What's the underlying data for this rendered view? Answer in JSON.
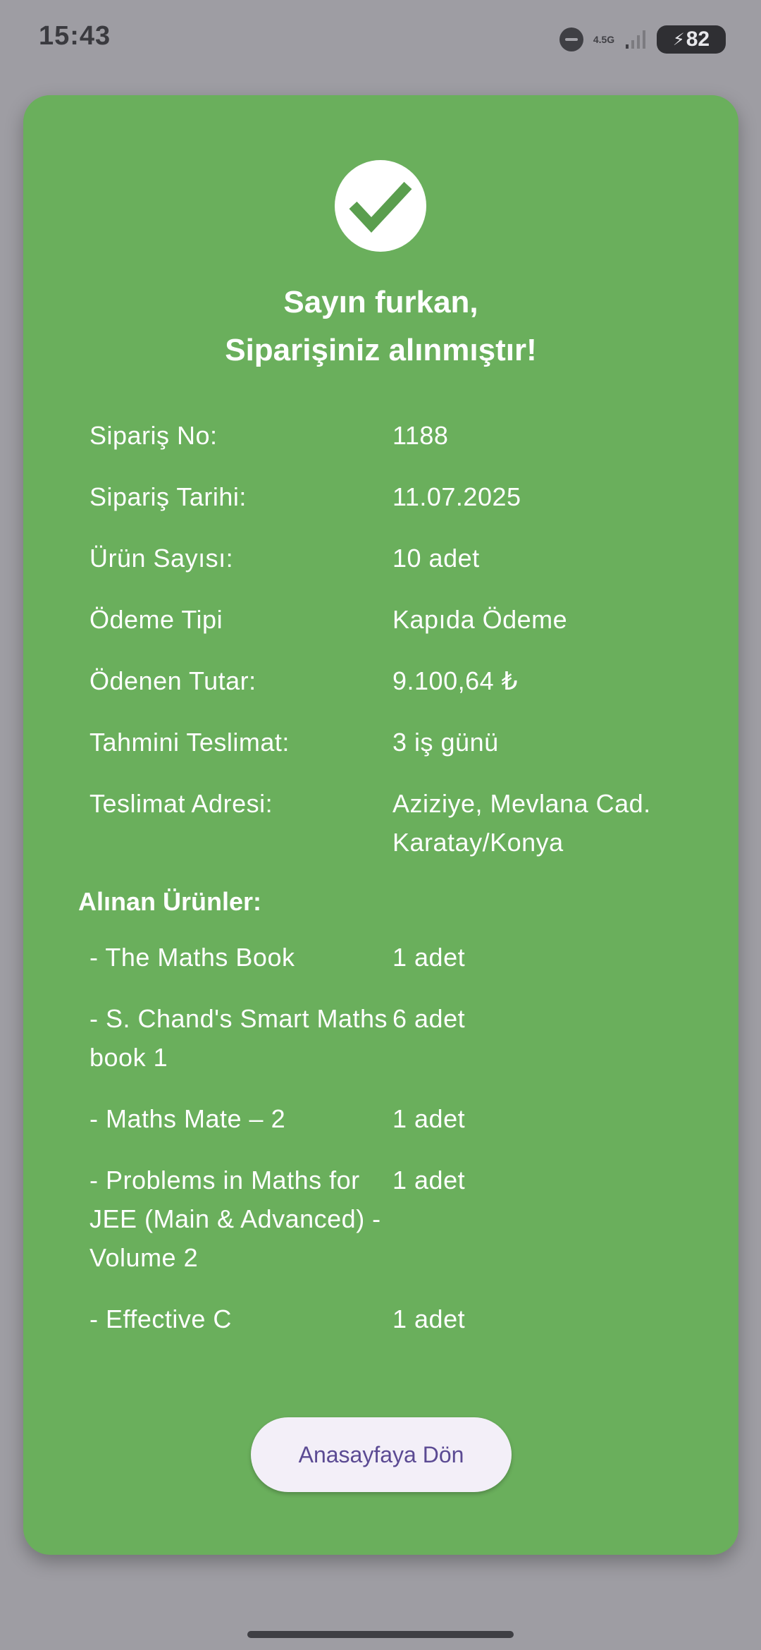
{
  "status_bar": {
    "time": "15:43",
    "network_type": "4.5G",
    "battery_level": "82"
  },
  "order": {
    "greeting": "Sayın furkan,",
    "confirmation": "Siparişiniz alınmıştır!",
    "details": [
      {
        "label": "Sipariş No:",
        "value": "1188"
      },
      {
        "label": "Sipariş Tarihi:",
        "value": "11.07.2025"
      },
      {
        "label": "Ürün Sayısı:",
        "value": "10 adet"
      },
      {
        "label": "Ödeme Tipi",
        "value": "Kapıda Ödeme"
      },
      {
        "label": "Ödenen Tutar:",
        "value": "9.100,64 ₺"
      },
      {
        "label": "Tahmini Teslimat:",
        "value": "3 iş günü"
      },
      {
        "label": "Teslimat Adresi:",
        "value": "Aziziye, Mevlana Cad. Karatay/Konya"
      }
    ],
    "products_heading": "Alınan Ürünler:",
    "products": [
      {
        "name": "- The Maths Book",
        "quantity": "1 adet"
      },
      {
        "name": "- S. Chand's Smart Maths book 1",
        "quantity": "6 adet"
      },
      {
        "name": "- Maths Mate – 2",
        "quantity": "1 adet"
      },
      {
        "name": "- Problems in Maths for JEE (Main & Advanced) - Volume 2",
        "quantity": "1 adet"
      },
      {
        "name": "- Effective C",
        "quantity": "1 adet"
      }
    ]
  },
  "actions": {
    "home_button_label": "Anasayfaya Dön"
  },
  "colors": {
    "card_background": "#6aaf5c",
    "page_background": "#9e9da3",
    "button_text": "#5b4a93"
  },
  "icons": [
    "do-not-disturb-icon",
    "signal-icon",
    "battery-icon",
    "charging-bolt-icon",
    "checkmark-icon"
  ]
}
